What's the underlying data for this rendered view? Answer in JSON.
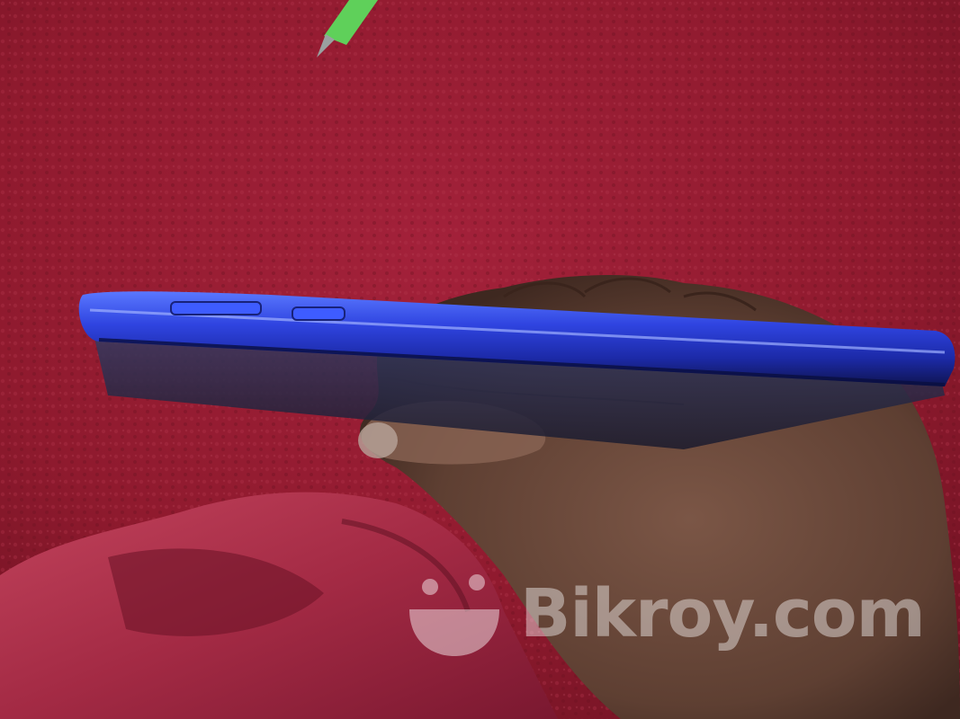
{
  "watermark": {
    "text": "Bikroy.com",
    "logo_icon": "bikroy-logo-icon"
  },
  "colors": {
    "carpet": "#9a1c30",
    "phone_blue": "#2a3fd6",
    "skin": "#6a4a3c",
    "watermark": "#ffffff"
  }
}
